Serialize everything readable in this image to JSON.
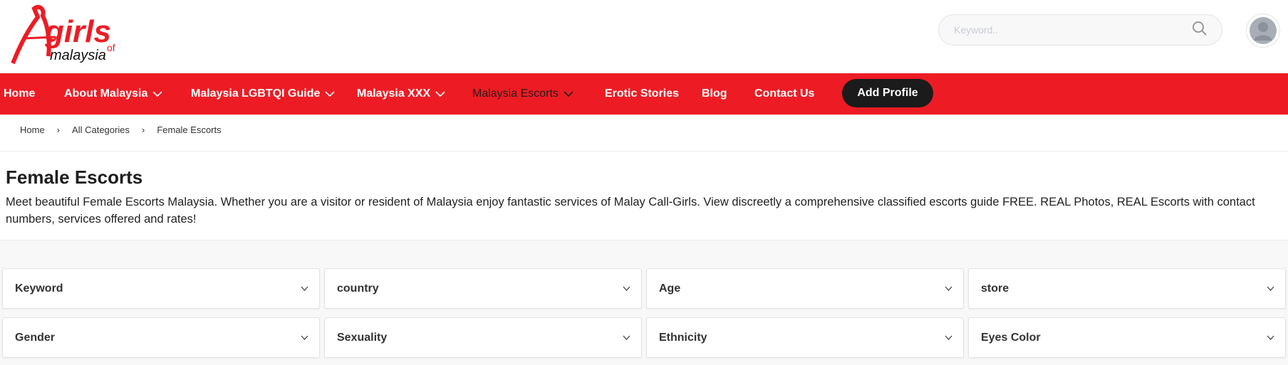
{
  "brand": {
    "logo_text": "Agirls of malaysia",
    "accent": "#ed1c24"
  },
  "search": {
    "placeholder": "Keyword..",
    "icon": "search-icon"
  },
  "avatar": {
    "icon": "user-icon"
  },
  "nav": {
    "items": [
      {
        "label": "Home",
        "dropdown": false
      },
      {
        "label": "About Malaysia",
        "dropdown": true
      },
      {
        "label": "Malaysia LGBTQI Guide",
        "dropdown": true
      },
      {
        "label": "Malaysia XXX",
        "dropdown": true
      },
      {
        "label": "Malaysia Escorts",
        "dropdown": true,
        "active": true
      },
      {
        "label": "Erotic Stories",
        "dropdown": false
      },
      {
        "label": "Blog",
        "dropdown": false
      },
      {
        "label": "Contact Us",
        "dropdown": false
      }
    ],
    "add_profile": "Add Profile"
  },
  "breadcrumb": {
    "items": [
      "Home",
      "All Categories",
      "Female Escorts"
    ],
    "separator": "›"
  },
  "page": {
    "title": "Female Escorts",
    "description": "Meet beautiful Female Escorts Malaysia. Whether you are a visitor or resident of Malaysia enjoy fantastic services of Malay Call-Girls. View discreetly a comprehensive classified escorts guide FREE. REAL Photos, REAL Escorts with contact numbers, services offered and rates!"
  },
  "filters": [
    "Keyword",
    "country",
    "Age",
    "store",
    "Gender",
    "Sexuality",
    "Ethnicity",
    "Eyes Color"
  ]
}
